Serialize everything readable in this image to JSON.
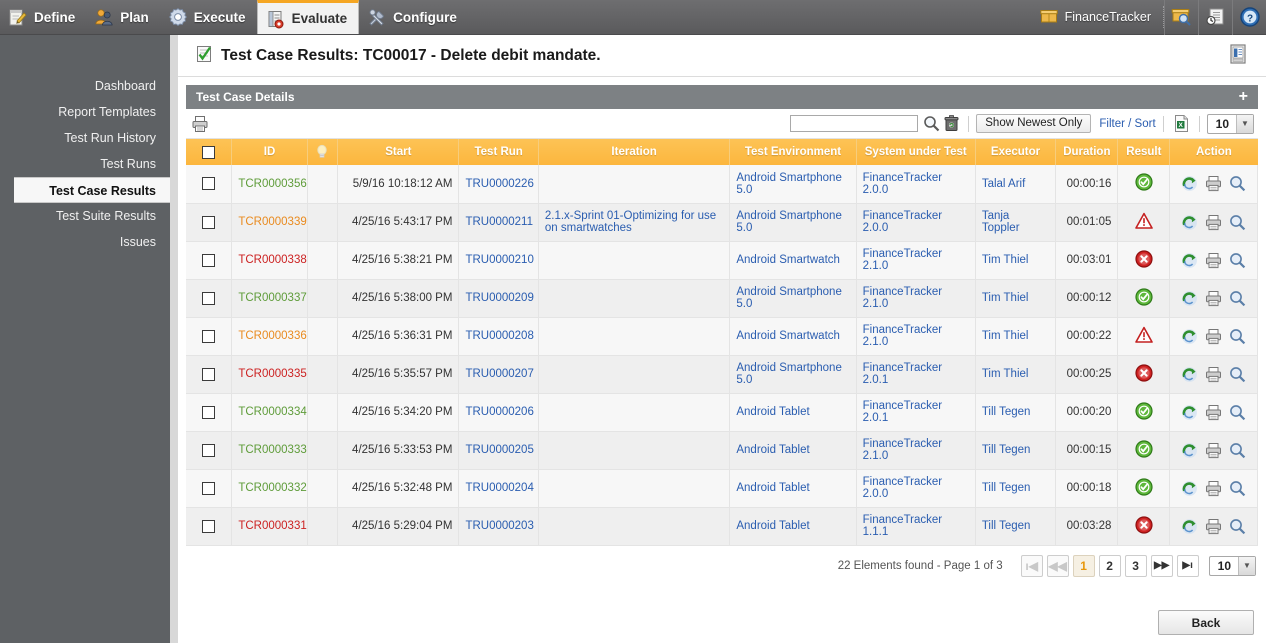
{
  "topnav": {
    "tabs": [
      {
        "label": "Define",
        "icon": "notepad-pencil-icon",
        "active": false
      },
      {
        "label": "Plan",
        "icon": "people-icon",
        "active": false
      },
      {
        "label": "Execute",
        "icon": "gear-icon",
        "active": false
      },
      {
        "label": "Evaluate",
        "icon": "report-icon",
        "active": true
      },
      {
        "label": "Configure",
        "icon": "tools-icon",
        "active": false
      }
    ],
    "project": {
      "label": "FinanceTracker",
      "icon": "box-icon"
    },
    "right_icons": [
      {
        "name": "search-project-icon"
      },
      {
        "name": "history-document-icon"
      },
      {
        "name": "help-icon"
      }
    ]
  },
  "sidebar": {
    "items": [
      {
        "label": "Dashboard",
        "active": false
      },
      {
        "label": "Report Templates",
        "active": false
      },
      {
        "label": "Test Run History",
        "active": false
      },
      {
        "label": "Test Runs",
        "active": false
      },
      {
        "label": "Test Case Results",
        "active": true
      },
      {
        "label": "Test Suite Results",
        "active": false
      },
      {
        "label": "Issues",
        "active": false
      }
    ]
  },
  "page": {
    "title": "Test Case Results: TC00017 - Delete debit mandate.",
    "title_icon": "checklist-icon",
    "doc_icon": "document-report-icon"
  },
  "panel": {
    "title": "Test Case Details",
    "expand_label": "+"
  },
  "toolbar": {
    "print_icon": "printer-icon",
    "search_value": "",
    "search_placeholder": "",
    "search_icon": "magnifier-icon",
    "clear_icon": "trash-icon",
    "show_newest_label": "Show Newest Only",
    "filter_sort_label": "Filter / Sort",
    "excel_icon": "excel-export-icon",
    "page_size": "10"
  },
  "table": {
    "columns": [
      "",
      "ID",
      "",
      "Start",
      "Test Run",
      "Iteration",
      "Test Environment",
      "System under Test",
      "Executor",
      "Duration",
      "Result",
      "Action"
    ],
    "bulb_icon": "lightbulb-icon",
    "rows": [
      {
        "id": "TCR0000356",
        "id_state": "pass",
        "start": "5/9/16 10:18:12 AM",
        "test_run": "TRU0000226",
        "iteration": "",
        "environment": "Android Smartphone 5.0",
        "sut": "FinanceTracker 2.0.0",
        "executor": "Talal Arif",
        "duration": "00:00:16",
        "result": "passed"
      },
      {
        "id": "TCR0000339",
        "id_state": "warn",
        "start": "4/25/16 5:43:17 PM",
        "test_run": "TRU0000211",
        "iteration": "2.1.x-Sprint 01-Optimizing for use on smartwatches",
        "environment": "Android Smartphone 5.0",
        "sut": "FinanceTracker 2.0.0",
        "executor": "Tanja Toppler",
        "duration": "00:01:05",
        "result": "warning"
      },
      {
        "id": "TCR0000338",
        "id_state": "fail",
        "start": "4/25/16 5:38:21 PM",
        "test_run": "TRU0000210",
        "iteration": "",
        "environment": "Android Smartwatch",
        "sut": "FinanceTracker 2.1.0",
        "executor": "Tim Thiel",
        "duration": "00:03:01",
        "result": "failed"
      },
      {
        "id": "TCR0000337",
        "id_state": "pass",
        "start": "4/25/16 5:38:00 PM",
        "test_run": "TRU0000209",
        "iteration": "",
        "environment": "Android Smartphone 5.0",
        "sut": "FinanceTracker 2.1.0",
        "executor": "Tim Thiel",
        "duration": "00:00:12",
        "result": "passed"
      },
      {
        "id": "TCR0000336",
        "id_state": "warn",
        "start": "4/25/16 5:36:31 PM",
        "test_run": "TRU0000208",
        "iteration": "",
        "environment": "Android Smartwatch",
        "sut": "FinanceTracker 2.1.0",
        "executor": "Tim Thiel",
        "duration": "00:00:22",
        "result": "warning"
      },
      {
        "id": "TCR0000335",
        "id_state": "fail",
        "start": "4/25/16 5:35:57 PM",
        "test_run": "TRU0000207",
        "iteration": "",
        "environment": "Android Smartphone 5.0",
        "sut": "FinanceTracker 2.0.1",
        "executor": "Tim Thiel",
        "duration": "00:00:25",
        "result": "failed"
      },
      {
        "id": "TCR0000334",
        "id_state": "pass",
        "start": "4/25/16 5:34:20 PM",
        "test_run": "TRU0000206",
        "iteration": "",
        "environment": "Android Tablet",
        "sut": "FinanceTracker 2.0.1",
        "executor": "Till Tegen",
        "duration": "00:00:20",
        "result": "passed"
      },
      {
        "id": "TCR0000333",
        "id_state": "pass",
        "start": "4/25/16 5:33:53 PM",
        "test_run": "TRU0000205",
        "iteration": "",
        "environment": "Android Tablet",
        "sut": "FinanceTracker 2.1.0",
        "executor": "Till Tegen",
        "duration": "00:00:15",
        "result": "passed"
      },
      {
        "id": "TCR0000332",
        "id_state": "pass",
        "start": "4/25/16 5:32:48 PM",
        "test_run": "TRU0000204",
        "iteration": "",
        "environment": "Android Tablet",
        "sut": "FinanceTracker 2.0.0",
        "executor": "Till Tegen",
        "duration": "00:00:18",
        "result": "passed"
      },
      {
        "id": "TCR0000331",
        "id_state": "fail",
        "start": "4/25/16 5:29:04 PM",
        "test_run": "TRU0000203",
        "iteration": "",
        "environment": "Android Tablet",
        "sut": "FinanceTracker 1.1.1",
        "executor": "Till Tegen",
        "duration": "00:03:28",
        "result": "failed"
      }
    ],
    "action_icons": [
      "rerun-icon",
      "print-icon",
      "details-magnifier-icon"
    ]
  },
  "footer": {
    "count_text": "22 Elements found - Page 1 of 3",
    "buttons": [
      {
        "label": "ı◀",
        "name": "page-first",
        "state": "disabled"
      },
      {
        "label": "◀◀",
        "name": "page-prev",
        "state": "disabled"
      },
      {
        "label": "1",
        "name": "page-1",
        "state": "current"
      },
      {
        "label": "2",
        "name": "page-2",
        "state": "normal"
      },
      {
        "label": "3",
        "name": "page-3",
        "state": "normal"
      },
      {
        "label": "▶▶",
        "name": "page-next",
        "state": "normal"
      },
      {
        "label": "▶ı",
        "name": "page-last",
        "state": "normal"
      }
    ],
    "page_size": "10",
    "back_label": "Back"
  },
  "colors": {
    "accent_orange": "#f5a623",
    "header_orange": "#fcb63e",
    "nav_gray": "#646466",
    "sidebar_gray": "#5e6164",
    "panel_gray": "#7d8184",
    "link_blue": "#2a5db0",
    "pass_green": "#5f9c3a",
    "warn_orange": "#e98b20",
    "fail_red": "#cc2222"
  }
}
